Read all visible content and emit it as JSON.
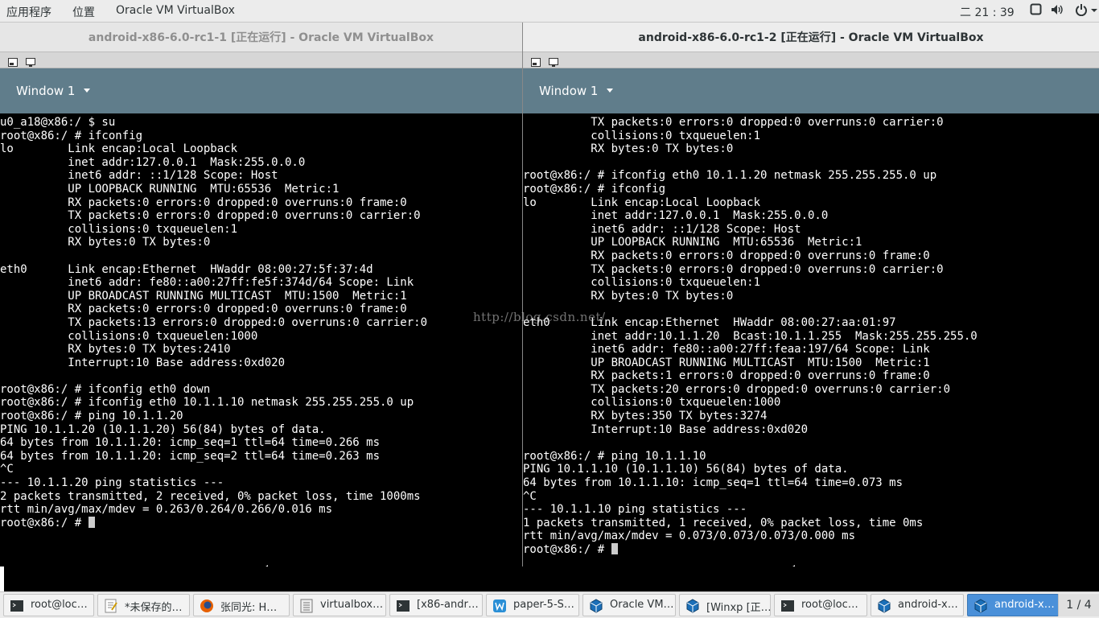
{
  "topbar": {
    "apps_menu": "应用程序",
    "places_menu": "位置",
    "app_name": "Oracle VM VirtualBox",
    "clock": "二 21 : 39"
  },
  "left_window": {
    "title": "android-x86-6.0-rc1-1 [正在运行] - Oracle VM VirtualBox",
    "window_selector": "Window 1",
    "terminal_lines": [
      "u0_a18@x86:/ $ su",
      "root@x86:/ # ifconfig",
      "lo        Link encap:Local Loopback",
      "          inet addr:127.0.0.1  Mask:255.0.0.0",
      "          inet6 addr: ::1/128 Scope: Host",
      "          UP LOOPBACK RUNNING  MTU:65536  Metric:1",
      "          RX packets:0 errors:0 dropped:0 overruns:0 frame:0",
      "          TX packets:0 errors:0 dropped:0 overruns:0 carrier:0",
      "          collisions:0 txqueuelen:1",
      "          RX bytes:0 TX bytes:0",
      "",
      "eth0      Link encap:Ethernet  HWaddr 08:00:27:5f:37:4d",
      "          inet6 addr: fe80::a00:27ff:fe5f:374d/64 Scope: Link",
      "          UP BROADCAST RUNNING MULTICAST  MTU:1500  Metric:1",
      "          RX packets:0 errors:0 dropped:0 overruns:0 frame:0",
      "          TX packets:13 errors:0 dropped:0 overruns:0 carrier:0",
      "          collisions:0 txqueuelen:1000",
      "          RX bytes:0 TX bytes:2410",
      "          Interrupt:10 Base address:0xd020",
      "",
      "root@x86:/ # ifconfig eth0 down",
      "root@x86:/ # ifconfig eth0 10.1.1.10 netmask 255.255.255.0 up",
      "root@x86:/ # ping 10.1.1.20",
      "PING 10.1.1.20 (10.1.1.20) 56(84) bytes of data.",
      "64 bytes from 10.1.1.20: icmp_seq=1 ttl=64 time=0.266 ms",
      "64 bytes from 10.1.1.20: icmp_seq=2 ttl=64 time=0.263 ms",
      "^C",
      "--- 10.1.1.20 ping statistics ---",
      "2 packets transmitted, 2 received, 0% packet loss, time 1000ms",
      "rtt min/avg/max/mdev = 0.263/0.264/0.266/0.016 ms"
    ],
    "prompt": "root@x86:/ # "
  },
  "right_window": {
    "title": "android-x86-6.0-rc1-2 [正在运行] - Oracle VM VirtualBox",
    "window_selector": "Window 1",
    "terminal_lines": [
      "          TX packets:0 errors:0 dropped:0 overruns:0 carrier:0",
      "          collisions:0 txqueuelen:1",
      "          RX bytes:0 TX bytes:0",
      "",
      "root@x86:/ # ifconfig eth0 10.1.1.20 netmask 255.255.255.0 up",
      "root@x86:/ # ifconfig",
      "lo        Link encap:Local Loopback",
      "          inet addr:127.0.0.1  Mask:255.0.0.0",
      "          inet6 addr: ::1/128 Scope: Host",
      "          UP LOOPBACK RUNNING  MTU:65536  Metric:1",
      "          RX packets:0 errors:0 dropped:0 overruns:0 frame:0",
      "          TX packets:0 errors:0 dropped:0 overruns:0 carrier:0",
      "          collisions:0 txqueuelen:1",
      "          RX bytes:0 TX bytes:0",
      "",
      "eth0      Link encap:Ethernet  HWaddr 08:00:27:aa:01:97",
      "          inet addr:10.1.1.20  Bcast:10.1.1.255  Mask:255.255.255.0",
      "          inet6 addr: fe80::a00:27ff:feaa:197/64 Scope: Link",
      "          UP BROADCAST RUNNING MULTICAST  MTU:1500  Metric:1",
      "          RX packets:1 errors:0 dropped:0 overruns:0 frame:0",
      "          TX packets:20 errors:0 dropped:0 overruns:0 carrier:0",
      "          collisions:0 txqueuelen:1000",
      "          RX bytes:350 TX bytes:3274",
      "          Interrupt:10 Base address:0xd020",
      "",
      "root@x86:/ # ping 10.1.1.10",
      "PING 10.1.1.10 (10.1.1.10) 56(84) bytes of data.",
      "64 bytes from 10.1.1.10: icmp_seq=1 ttl=64 time=0.073 ms",
      "^C",
      "--- 10.1.1.10 ping statistics ---",
      "1 packets transmitted, 1 received, 0% packet loss, time 0ms",
      "rtt min/avg/max/mdev = 0.073/0.073/0.073/0.000 ms"
    ],
    "prompt": "root@x86:/ # "
  },
  "watermark": "http://blog.csdn.net/",
  "taskbar": {
    "tasks": [
      {
        "label": "root@loc…",
        "icon": "terminal-icon"
      },
      {
        "label": "*未保存的…",
        "icon": "text-editor-icon"
      },
      {
        "label": "张同光: H…",
        "icon": "firefox-icon"
      },
      {
        "label": "virtualbox…",
        "icon": "file-manager-icon"
      },
      {
        "label": "[x86-andr…",
        "icon": "terminal-icon"
      },
      {
        "label": "paper-5-S…",
        "icon": "wps-icon"
      },
      {
        "label": "Oracle VM…",
        "icon": "virtualbox-icon"
      },
      {
        "label": "[Winxp [正…",
        "icon": "virtualbox-icon"
      },
      {
        "label": "root@loc…",
        "icon": "terminal-icon"
      },
      {
        "label": "android-x…",
        "icon": "virtualbox-icon"
      },
      {
        "label": "android-x…",
        "icon": "virtualbox-icon"
      }
    ],
    "workspace_pager": "1 / 4"
  },
  "colors": {
    "android_toolbar": "#607d8b",
    "terminal_bg": "#000000",
    "terminal_fg": "#ffffff",
    "active_task": "#4a90d9"
  }
}
